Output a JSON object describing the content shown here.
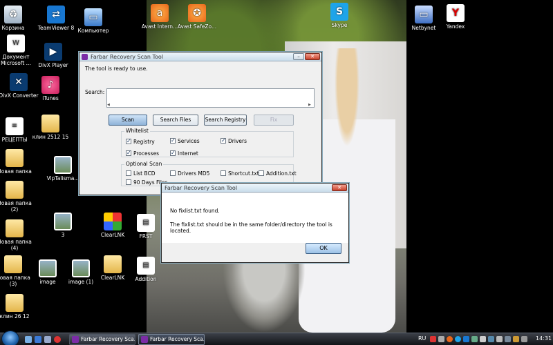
{
  "desktop": {
    "icons": [
      {
        "label": "Корзина",
        "icon": "recycle-bin-icon"
      },
      {
        "label": "TeamViewer 8",
        "icon": "teamviewer-icon"
      },
      {
        "label": "Компьютер",
        "icon": "computer-icon"
      },
      {
        "label": "Avast Intern...",
        "icon": "avast-icon"
      },
      {
        "label": "Avast SafeZo...",
        "icon": "avast-safezone-icon"
      },
      {
        "label": "Skype",
        "icon": "skype-icon"
      },
      {
        "label": "Netbynet",
        "icon": "network-icon"
      },
      {
        "label": "Yandex",
        "icon": "yandex-icon"
      },
      {
        "label": "Документ Microsoft ...",
        "icon": "word-document-icon"
      },
      {
        "label": "DivX Player",
        "icon": "divx-player-icon"
      },
      {
        "label": "DivX Converter",
        "icon": "divx-converter-icon"
      },
      {
        "label": "iTunes",
        "icon": "itunes-icon"
      },
      {
        "label": "РЕЦЕПТЫ",
        "icon": "document-icon"
      },
      {
        "label": "клин 2512 15",
        "icon": "folder-icon"
      },
      {
        "label": "Новая папка",
        "icon": "folder-icon"
      },
      {
        "label": "VipTalisma...",
        "icon": "photo-icon"
      },
      {
        "label": "Новая папка (2)",
        "icon": "folder-icon"
      },
      {
        "label": "3",
        "icon": "photo-icon"
      },
      {
        "label": "ClearLNK",
        "icon": "clearlnk-icon"
      },
      {
        "label": "FRST",
        "icon": "file-icon"
      },
      {
        "label": "Новая папка (4)",
        "icon": "folder-icon"
      },
      {
        "label": "Новая папка (3)",
        "icon": "folder-icon"
      },
      {
        "label": "image",
        "icon": "photo-icon"
      },
      {
        "label": "image (1)",
        "icon": "photo-icon"
      },
      {
        "label": "ClearLNK",
        "icon": "folder-icon"
      },
      {
        "label": "Addition",
        "icon": "file-icon"
      },
      {
        "label": "клин 26 12",
        "icon": "folder-icon"
      }
    ]
  },
  "frst_window": {
    "title": "Farbar Recovery Scan Tool",
    "status": "The tool is ready to use.",
    "search_label": "Search:",
    "buttons": {
      "scan": "Scan",
      "search_files": "Search Files",
      "search_registry": "Search Registry",
      "fix": "Fix"
    },
    "whitelist": {
      "legend": "Whitelist",
      "items": [
        {
          "label": "Registry",
          "checked": true
        },
        {
          "label": "Services",
          "checked": true
        },
        {
          "label": "Drivers",
          "checked": true
        },
        {
          "label": "Processes",
          "checked": true
        },
        {
          "label": "Internet",
          "checked": true
        }
      ]
    },
    "optional_scan": {
      "legend": "Optional Scan",
      "items": [
        {
          "label": "List BCD",
          "checked": false
        },
        {
          "label": "Drivers MD5",
          "checked": false
        },
        {
          "label": "Shortcut.txt",
          "checked": false
        },
        {
          "label": "Addition.txt",
          "checked": false
        },
        {
          "label": "90 Days Files",
          "checked": false
        }
      ]
    }
  },
  "message_box": {
    "title": "Farbar Recovery Scan Tool",
    "line1": "No fixlist.txt found.",
    "line2": "The fixlist.txt should be in the same folder/directory the tool is located.",
    "ok_label": "OK"
  },
  "taskbar": {
    "tasks": [
      {
        "label": "Farbar Recovery Sca...",
        "active": false
      },
      {
        "label": "Farbar Recovery Sca...",
        "active": true
      }
    ],
    "language": "RU",
    "clock": "14:31"
  },
  "colors": {
    "desktop_background": "#000000",
    "frst_icon": "#7b2ca6",
    "close_button": "#c8412b"
  }
}
